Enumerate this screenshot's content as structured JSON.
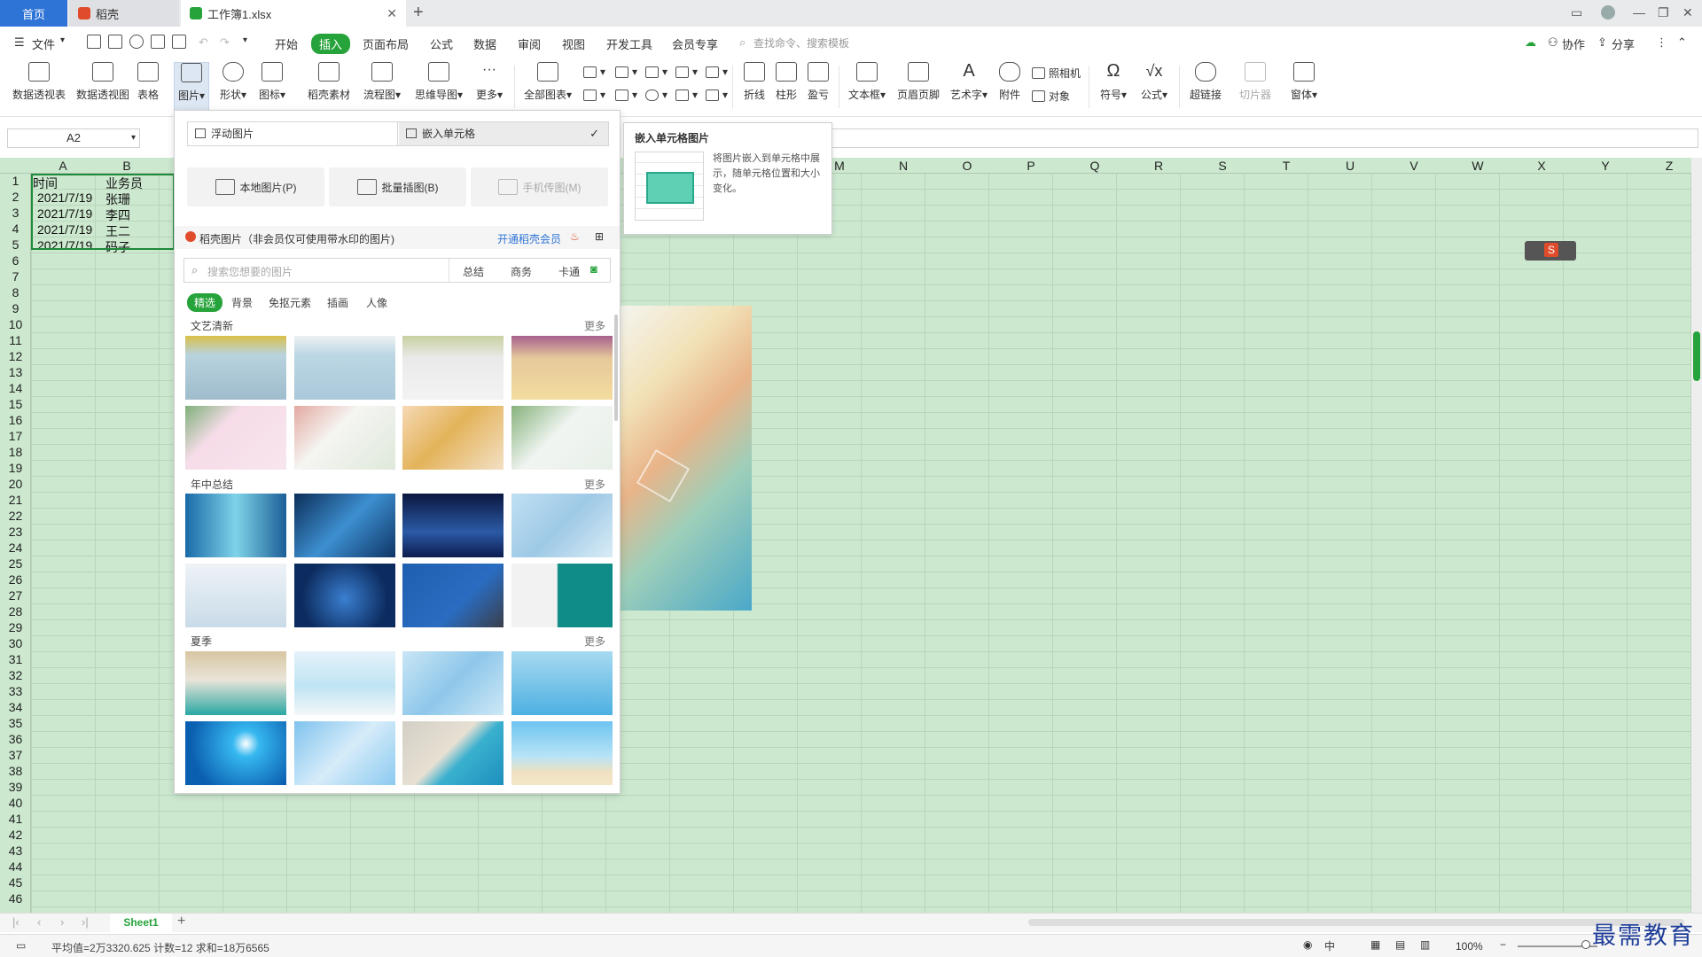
{
  "tabs": {
    "home": "首页",
    "docer": "稻壳",
    "workbook": "工作簿1.xlsx",
    "add": "+"
  },
  "menu": {
    "file": "文件",
    "items": [
      "开始",
      "插入",
      "页面布局",
      "公式",
      "数据",
      "审阅",
      "视图",
      "开发工具",
      "会员专享"
    ],
    "active_index": 1,
    "search_placeholder": "查找命令、搜索模板",
    "collab": "协作",
    "share": "分享"
  },
  "ribbon": {
    "pivot_table": "数据透视表",
    "pivot_chart": "数据透视图",
    "table": "表格",
    "picture": "图片",
    "shape": "形状",
    "icon": "图标",
    "docer_material": "稻壳素材",
    "flowchart": "流程图",
    "mindmap": "思维导图",
    "more": "更多",
    "all_charts": "全部图表",
    "line": "折线",
    "column": "柱形",
    "win_loss": "盈亏",
    "textbox": "文本框",
    "header_footer": "页眉页脚",
    "wordart": "艺术字",
    "attachment": "附件",
    "camera": "照相机",
    "object": "对象",
    "symbol": "符号",
    "formula": "公式",
    "hyperlink": "超链接",
    "slicer": "切片器",
    "form": "窗体"
  },
  "namebox": "A2",
  "columns": [
    "A",
    "B",
    "",
    "",
    "",
    "",
    "",
    "",
    "",
    "",
    "M",
    "N",
    "O",
    "P",
    "Q",
    "R",
    "S",
    "T",
    "U",
    "V",
    "W",
    "X",
    "Y",
    "Z"
  ],
  "rows": [
    "1",
    "2",
    "3",
    "4",
    "5",
    "6",
    "7",
    "8",
    "9",
    "10",
    "11",
    "12",
    "13",
    "14",
    "15",
    "16",
    "17",
    "18",
    "19",
    "20",
    "21",
    "22",
    "23",
    "24",
    "25",
    "26",
    "27",
    "28",
    "29",
    "30",
    "31",
    "32",
    "33",
    "34",
    "35",
    "36",
    "37",
    "38",
    "39",
    "40",
    "41",
    "42",
    "43",
    "44",
    "45",
    "46"
  ],
  "cells": {
    "a1": "时间",
    "b1": "业务员",
    "a2": "2021/7/19",
    "b2": "张珊",
    "a3": "2021/7/19",
    "b3": "李四",
    "a4": "2021/7/19",
    "b4": "王二",
    "a5": "2021/7/19",
    "b5": "码子"
  },
  "picture_panel": {
    "float_picture": "浮动图片",
    "embed_cell": "嵌入单元格",
    "local_picture": "本地图片(P)",
    "batch_insert": "批量插图(B)",
    "phone_upload": "手机传图(M)",
    "docer_pictures": "稻壳图片（非会员仅可使用带水印的图片)",
    "open_member": "开通稻壳会员",
    "search_placeholder": "搜索您想要的图片",
    "search_cats": [
      "总结",
      "商务",
      "卡通"
    ],
    "filters": [
      "精选",
      "背景",
      "免抠元素",
      "插画",
      "人像"
    ],
    "sections": [
      {
        "title": "文艺清新",
        "more": "更多"
      },
      {
        "title": "年中总结",
        "more": "更多"
      },
      {
        "title": "夏季",
        "more": "更多"
      }
    ]
  },
  "tooltip": {
    "title": "嵌入单元格图片",
    "body": "将图片嵌入到单元格中展示，随单元格位置和大小变化。"
  },
  "sheet_tab": "Sheet1",
  "status": {
    "text": "平均值=2万3320.625  计数=12  求和=18万6565",
    "zoom": "100%"
  },
  "watermark": "最需教育",
  "colors": {
    "accent": "#27a33b",
    "home_tab": "#2e73d6",
    "sheet_bg": "#cce8cf"
  }
}
